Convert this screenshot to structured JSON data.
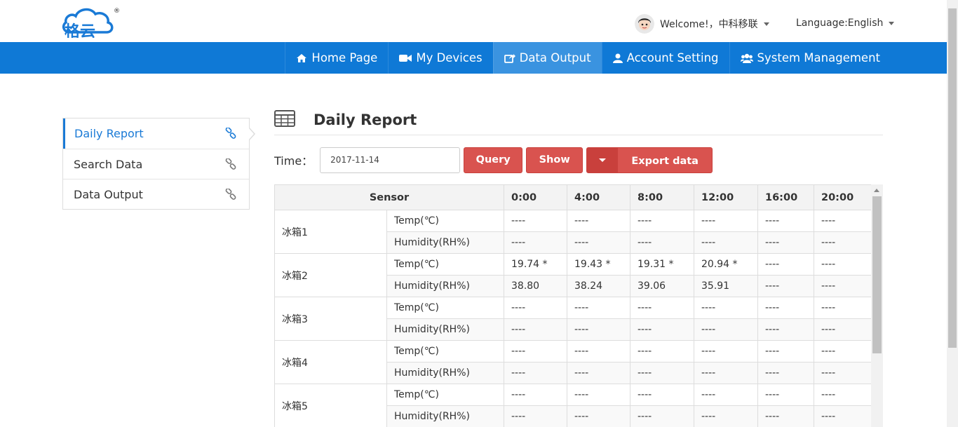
{
  "header": {
    "logo_text": "格云",
    "welcome": "Welcome!，中科移联",
    "language": "Language:English"
  },
  "nav": [
    {
      "label": "Home Page",
      "icon": "home-icon",
      "active": false
    },
    {
      "label": "My Devices",
      "icon": "video-camera-icon",
      "active": false
    },
    {
      "label": "Data Output",
      "icon": "share-icon",
      "active": true
    },
    {
      "label": "Account Setting",
      "icon": "user-icon",
      "active": false
    },
    {
      "label": "System Management",
      "icon": "users-icon",
      "active": false
    }
  ],
  "sidebar": {
    "items": [
      {
        "label": "Daily Report",
        "active": true
      },
      {
        "label": "Search Data",
        "active": false
      },
      {
        "label": "Data Output",
        "active": false
      }
    ]
  },
  "main": {
    "title": "Daily Report",
    "time_label": "Time：",
    "date_value": "2017-11-14",
    "query_label": "Query",
    "show_label": "Show",
    "export_label": "Export data"
  },
  "table": {
    "headers": [
      "Sensor",
      "0:00",
      "4:00",
      "8:00",
      "12:00",
      "16:00",
      "20:00"
    ],
    "rows": [
      {
        "name": "冰箱1",
        "temp": [
          "----",
          "----",
          "----",
          "----",
          "----",
          "----"
        ],
        "hum": [
          "----",
          "----",
          "----",
          "----",
          "----",
          "----"
        ]
      },
      {
        "name": "冰箱2",
        "temp": [
          "19.74 *",
          "19.43 *",
          "19.31 *",
          "20.94 *",
          "----",
          "----"
        ],
        "hum": [
          "38.80",
          "38.24",
          "39.06",
          "35.91",
          "----",
          "----"
        ]
      },
      {
        "name": "冰箱3",
        "temp": [
          "----",
          "----",
          "----",
          "----",
          "----",
          "----"
        ],
        "hum": [
          "----",
          "----",
          "----",
          "----",
          "----",
          "----"
        ]
      },
      {
        "name": "冰箱4",
        "temp": [
          "----",
          "----",
          "----",
          "----",
          "----",
          "----"
        ],
        "hum": [
          "----",
          "----",
          "----",
          "----",
          "----",
          "----"
        ]
      },
      {
        "name": "冰箱5",
        "temp": [
          "----",
          "----",
          "----",
          "----",
          "----",
          "----"
        ],
        "hum": [
          "----",
          "----",
          "----",
          "----",
          "----",
          "----"
        ]
      }
    ],
    "temp_label": "Temp(℃)",
    "hum_label": "Humidity(RH%)"
  },
  "colors": {
    "nav_bg": "#0f79d6",
    "nav_active": "#3a93e0",
    "accent": "#1a7ad6",
    "button_red": "#d9534f"
  }
}
